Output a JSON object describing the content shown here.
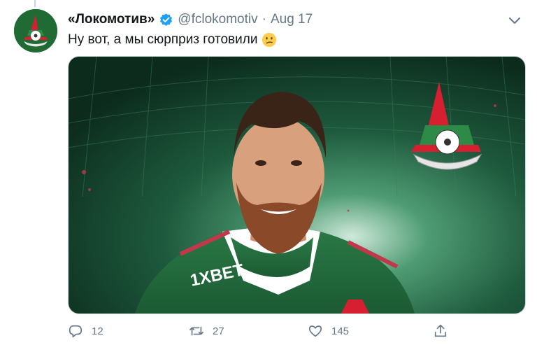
{
  "tweet": {
    "display_name": "«Локомотив»",
    "handle": "@fclokomotiv",
    "separator": "·",
    "date": "Aug 17",
    "text": "Ну вот, а мы сюрприз готовили",
    "emoji": "confused-face",
    "media": {
      "jersey_sponsor": "1XBET"
    }
  },
  "actions": {
    "reply_count": "12",
    "retweet_count": "27",
    "like_count": "145"
  },
  "icons": [
    "verified-badge-icon",
    "chevron-down-icon",
    "reply-icon",
    "retweet-icon",
    "like-icon",
    "share-icon"
  ],
  "colors": {
    "verified": "#1da1f2",
    "secondary_text": "#657786",
    "club_red": "#d62032",
    "club_green": "#1f6b33"
  }
}
